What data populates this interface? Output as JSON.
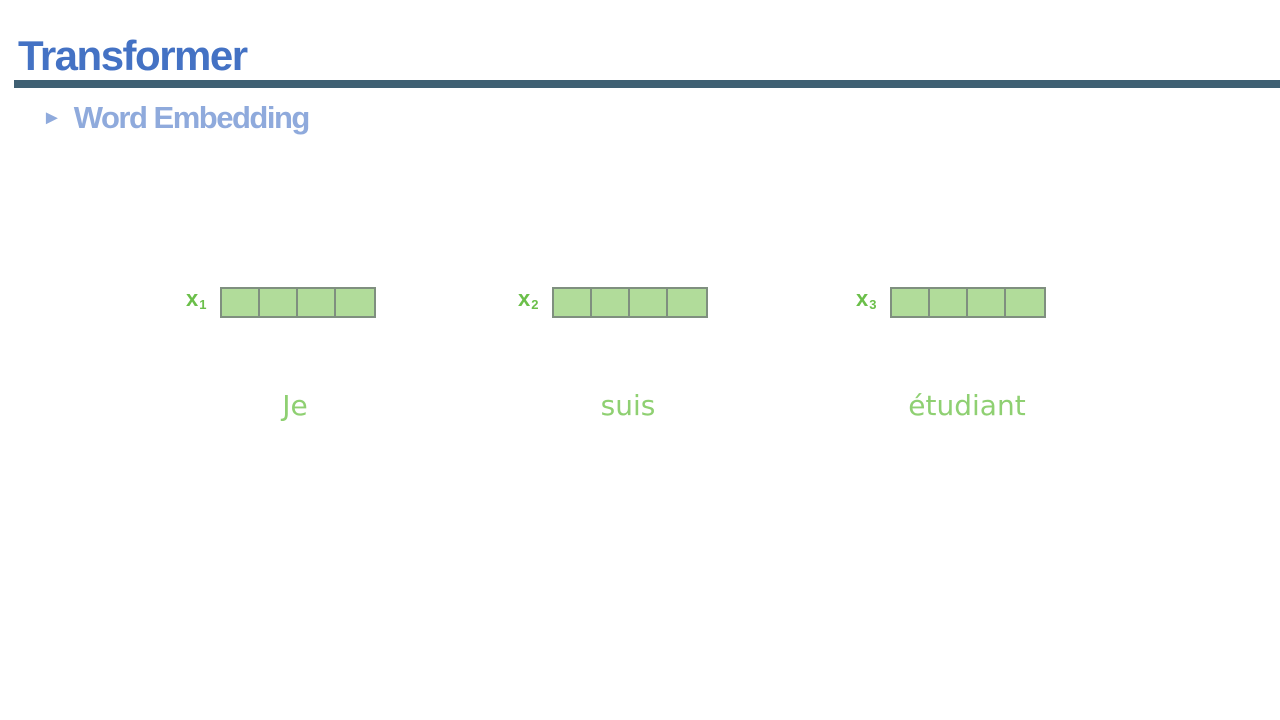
{
  "slide": {
    "title": "Transformer",
    "bullet_marker": "►",
    "bullet_text": "Word Embedding"
  },
  "diagram": {
    "vectors": [
      {
        "var": "x",
        "sub": "1",
        "cells": 4,
        "word": "Je"
      },
      {
        "var": "x",
        "sub": "2",
        "cells": 4,
        "word": "suis"
      },
      {
        "var": "x",
        "sub": "3",
        "cells": 4,
        "word": "étudiant"
      }
    ],
    "colors": {
      "title": "#4472c4",
      "rule": "#3f6073",
      "bullet": "#8faadc",
      "vector_fill": "#b1dc9a",
      "vector_border": "#7f8f7f",
      "label": "#6bbf4a",
      "word": "#8fd072"
    }
  }
}
